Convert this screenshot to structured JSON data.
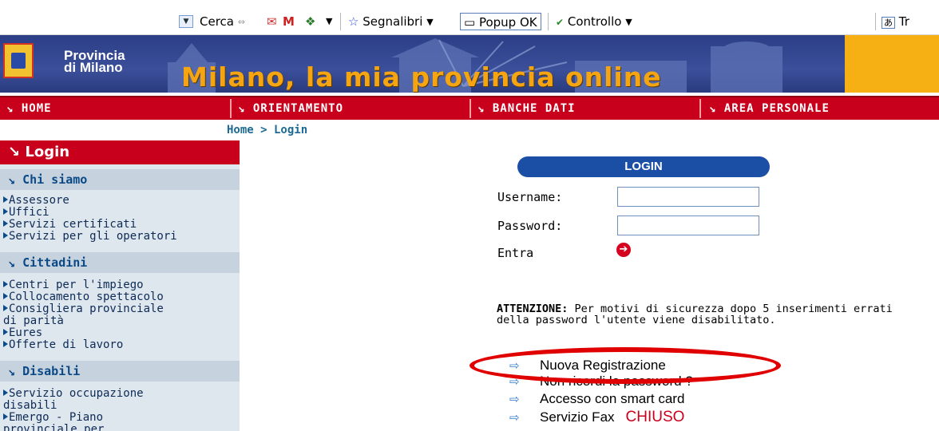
{
  "toolbar": {
    "cerca": "Cerca",
    "segnalibri": "Segnalibri",
    "popup": "Popup OK",
    "controllo": "Controllo",
    "translate": "Tr"
  },
  "banner": {
    "prov_line1": "Provincia",
    "prov_line2": "di Milano",
    "slogan": "Milano, la mia provincia online"
  },
  "nav": [
    "HOME",
    "ORIENTAMENTO",
    "BANCHE DATI",
    "AREA PERSONALE"
  ],
  "breadcrumb": "Home > Login",
  "sidebar": {
    "login": "Login",
    "sections": [
      {
        "title": "Chi siamo",
        "items": [
          "Assessore",
          "Uffici",
          "Servizi certificati",
          "Servizi per gli operatori"
        ]
      },
      {
        "title": "Cittadini",
        "items": [
          "Centri per l'impiego",
          "Collocamento spettacolo",
          "Consigliera provinciale",
          "di parità",
          "Eures",
          "Offerte di lavoro"
        ]
      },
      {
        "title": "Disabili",
        "items": [
          "Servizio occupazione",
          "disabili",
          "Emergo - Piano",
          "provinciale per"
        ]
      }
    ]
  },
  "login": {
    "title": "LOGIN",
    "username_label": "Username:",
    "password_label": "Password:",
    "entra": "Entra"
  },
  "warning": {
    "bold": "ATTENZIONE:",
    "text": "Per motivi di sicurezza dopo 5 inserimenti errati della password l'utente viene disabilitato."
  },
  "links": [
    "Nuova Registrazione",
    "Non ricordi la password ?",
    "Accesso con smart card",
    "Servizio Fax"
  ],
  "chiuso": "CHIUSO",
  "colors": {
    "nav_red": "#c8001c",
    "login_blue": "#1b4fa6",
    "highlight_oval": "#e00000"
  }
}
